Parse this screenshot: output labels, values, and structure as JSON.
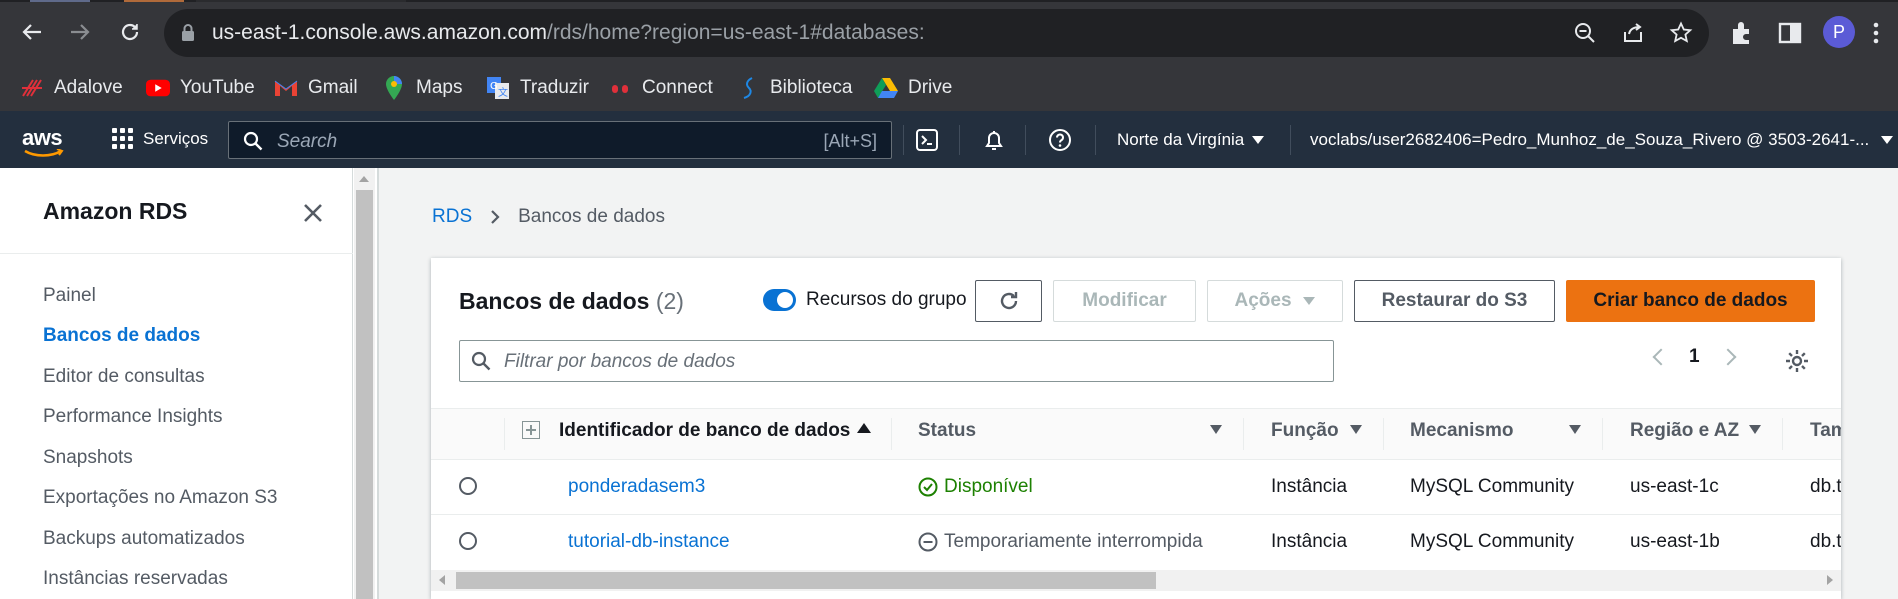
{
  "browser": {
    "url_host": "us-east-1.console.aws.amazon.com",
    "url_path": "/rds/home?region=us-east-1#databases:",
    "profile_initial": "P",
    "bookmarks": [
      {
        "label": "Adalove",
        "icon": "adalove-icon"
      },
      {
        "label": "YouTube",
        "icon": "youtube-icon"
      },
      {
        "label": "Gmail",
        "icon": "gmail-icon"
      },
      {
        "label": "Maps",
        "icon": "maps-icon"
      },
      {
        "label": "Traduzir",
        "icon": "translate-icon"
      },
      {
        "label": "Connect",
        "icon": "connect-icon"
      },
      {
        "label": "Biblioteca",
        "icon": "library-icon"
      },
      {
        "label": "Drive",
        "icon": "drive-icon"
      }
    ]
  },
  "aws_nav": {
    "logo": "aws",
    "services_label": "Serviços",
    "search_placeholder": "Search",
    "search_shortcut": "[Alt+S]",
    "region": "Norte da Virgínia",
    "account": "voclabs/user2682406=Pedro_Munhoz_de_Souza_Rivero @ 3503-2641-..."
  },
  "sidebar": {
    "title": "Amazon RDS",
    "items": [
      {
        "label": "Painel",
        "active": false
      },
      {
        "label": "Bancos de dados",
        "active": true
      },
      {
        "label": "Editor de consultas",
        "active": false
      },
      {
        "label": "Performance Insights",
        "active": false
      },
      {
        "label": "Snapshots",
        "active": false
      },
      {
        "label": "Exportações no Amazon S3",
        "active": false
      },
      {
        "label": "Backups automatizados",
        "active": false
      },
      {
        "label": "Instâncias reservadas",
        "active": false
      }
    ]
  },
  "breadcrumb": {
    "root": "RDS",
    "current": "Bancos de dados"
  },
  "panel": {
    "title": "Bancos de dados",
    "count": "(2)",
    "toggle_label": "Recursos do grupo",
    "buttons": {
      "modify": "Modificar",
      "actions": "Ações",
      "restore": "Restaurar do S3",
      "create": "Criar banco de dados"
    },
    "filter_placeholder": "Filtrar por bancos de dados",
    "page": "1"
  },
  "table": {
    "columns": [
      "Identificador de banco de dados",
      "Status",
      "Função",
      "Mecanismo",
      "Região e AZ",
      "Tam"
    ],
    "rows": [
      {
        "id": "ponderadasem3",
        "status": "Disponível",
        "status_kind": "ok",
        "role": "Instância",
        "engine": "MySQL Community",
        "region": "us-east-1c",
        "size": "db.t"
      },
      {
        "id": "tutorial-db-instance",
        "status": "Temporariamente interrompida",
        "status_kind": "stopped",
        "role": "Instância",
        "engine": "MySQL Community",
        "region": "us-east-1b",
        "size": "db.t"
      }
    ]
  },
  "colors": {
    "aws_nav": "#232f3e",
    "link": "#0972d3",
    "primary_button": "#ec7211",
    "available": "#1d8102"
  }
}
